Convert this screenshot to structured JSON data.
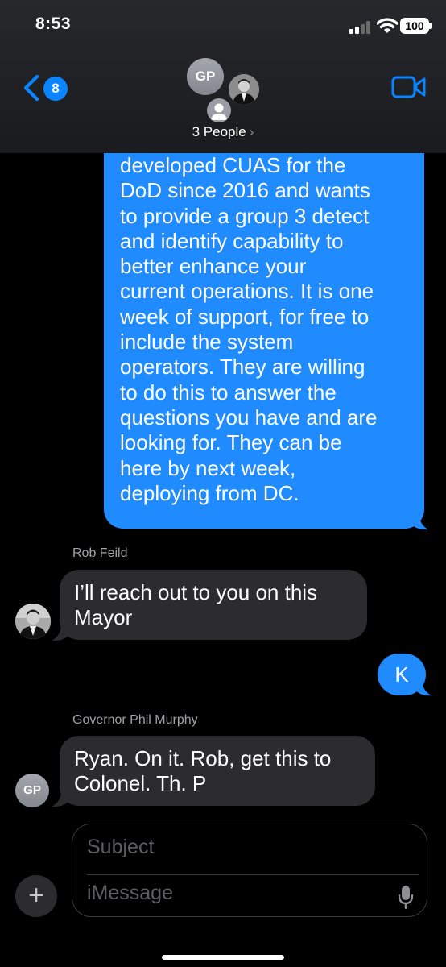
{
  "status_bar": {
    "time": "8:53",
    "battery": "100"
  },
  "nav": {
    "back_badge": "8",
    "group_avatar_initials": "GP",
    "group_label": "3 People",
    "group_chevron": "›"
  },
  "messages": {
    "outgoing_long": {
      "lines": [
        "developed CUAS for the",
        "DoD since 2016 and wants",
        "to provide a group 3 detect",
        "and identify capability to",
        "better enhance your",
        "current operations.  It is one",
        "week of support, for free to",
        "include the system",
        "operators.  They are willing",
        "to do this to answer the",
        "questions you have and are",
        "looking for.  They can be",
        "here by next week,",
        "deploying from DC."
      ]
    },
    "rob": {
      "sender": "Rob Feild",
      "lines": [
        "I’ll reach out to you on this",
        "Mayor"
      ]
    },
    "outgoing_k": {
      "text": "K"
    },
    "governor": {
      "sender": "Governor  Phil Murphy",
      "avatar_initials": "GP",
      "lines": [
        "Ryan. On it. Rob, get this to",
        "Colonel. Th. P"
      ]
    }
  },
  "compose": {
    "plus": "+",
    "subject_placeholder": "Subject",
    "body_placeholder": "iMessage"
  },
  "colors": {
    "bubble_outgoing": "#1f8bff",
    "bubble_incoming": "#2c2c2e",
    "accent": "#0a84ff"
  }
}
